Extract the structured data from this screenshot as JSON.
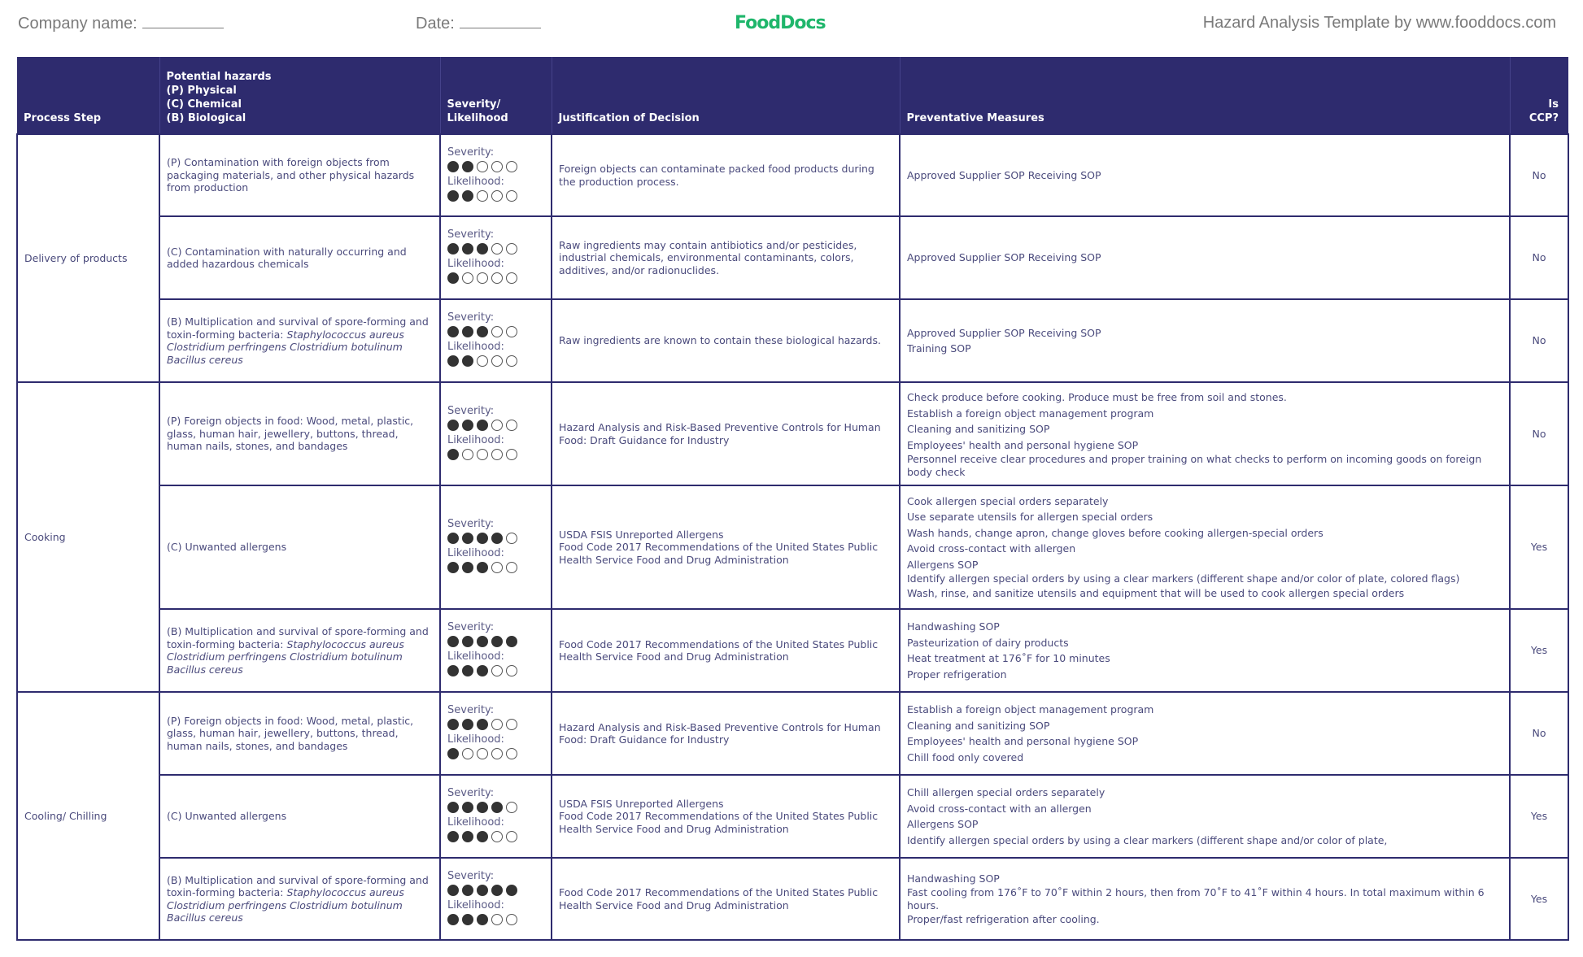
{
  "header": {
    "company_label": "Company name:",
    "date_label": "Date:",
    "logo_text": "FoodDocs",
    "credit": "Hazard Analysis Template by www.fooddocs.com"
  },
  "colors": {
    "header_bg": "#2e2b6e",
    "logo_green": "#1fb66b",
    "dot_filled": "#333333"
  },
  "columns": {
    "process_step": "Process Step",
    "hazards_title": "Potential hazards",
    "hazards_p": "(P) Physical",
    "hazards_c": "(C) Chemical",
    "hazards_b": "(B) Biological",
    "sev_line1": "Severity/",
    "sev_line2": "Likelihood",
    "justification": "Justification of Decision",
    "measures": "Preventative Measures",
    "ccp": "Is CCP?"
  },
  "labels": {
    "severity": "Severity:",
    "likelihood": "Likelihood:"
  },
  "steps": [
    {
      "name": "Delivery of products",
      "rows": [
        {
          "hazard": "(P) Contamination with foreign objects from packaging materials, and other physical hazards from production",
          "hazard_italic": "",
          "severity": 2,
          "likelihood": 2,
          "justification": [
            "Foreign objects can contaminate packed food products during the production process."
          ],
          "measures": [
            "Approved Supplier SOP Receiving SOP"
          ],
          "ccp": "No"
        },
        {
          "hazard": "(C) Contamination with naturally occurring and added hazardous chemicals",
          "hazard_italic": "",
          "severity": 3,
          "likelihood": 1,
          "justification": [
            "Raw ingredients may contain antibiotics and/or pesticides, industrial chemicals, environmental contaminants, colors, additives, and/or radionuclides."
          ],
          "measures": [
            "Approved Supplier SOP Receiving SOP"
          ],
          "ccp": "No"
        },
        {
          "hazard": "(B) Multiplication and survival of spore-forming and toxin-forming bacteria: ",
          "hazard_italic": "Staphylococcus aureus Clostridium perfringens Clostridium botulinum Bacillus cereus",
          "severity": 3,
          "likelihood": 2,
          "justification": [
            "Raw ingredients are known to contain these biological hazards."
          ],
          "measures": [
            "Approved Supplier SOP Receiving SOP",
            "Training SOP"
          ],
          "ccp": "No"
        }
      ]
    },
    {
      "name": "Cooking",
      "rows": [
        {
          "hazard": "(P) Foreign objects in food: Wood, metal, plastic, glass, human hair, jewellery, buttons, thread, human nails, stones, and bandages",
          "hazard_italic": "",
          "severity": 3,
          "likelihood": 1,
          "justification": [
            "Hazard Analysis and Risk-Based Preventive Controls for Human Food: Draft Guidance for Industry"
          ],
          "measures": [
            "Check produce before cooking. Produce must be free from soil and stones.",
            "Establish a foreign object management program",
            "Cleaning and sanitizing SOP",
            "Employees' health and personal hygiene SOP",
            "Personnel receive clear procedures and proper training on what checks to perform on incoming goods on foreign body check"
          ],
          "ccp": "No"
        },
        {
          "hazard": "(C) Unwanted allergens",
          "hazard_italic": "",
          "severity": 4,
          "likelihood": 3,
          "justification": [
            "USDA FSIS Unreported Allergens",
            "Food Code 2017 Recommendations of the United States Public Health Service Food and Drug Administration"
          ],
          "measures": [
            "Cook allergen special orders separately",
            "Use separate utensils for allergen special orders",
            "Wash hands, change apron, change gloves before cooking allergen-special orders",
            "Avoid cross-contact with allergen",
            "Allergens SOP",
            "Identify allergen special orders by using a clear markers (different shape and/or color of plate, colored flags)",
            "Wash, rinse, and sanitize utensils and equipment that will be used to cook allergen special orders"
          ],
          "ccp": "Yes"
        },
        {
          "hazard": "(B) Multiplication and survival of spore-forming and toxin-forming bacteria: ",
          "hazard_italic": "Staphylococcus aureus Clostridium perfringens Clostridium botulinum Bacillus cereus",
          "severity": 5,
          "likelihood": 3,
          "justification": [
            "Food Code 2017 Recommendations of the United States Public Health Service Food and Drug Administration"
          ],
          "measures": [
            "Handwashing SOP",
            "Pasteurization of dairy products",
            "Heat treatment at 176˚F for 10 minutes",
            "Proper refrigeration"
          ],
          "ccp": "Yes"
        }
      ]
    },
    {
      "name": "Cooling/ Chilling",
      "rows": [
        {
          "hazard": "(P) Foreign objects in food: Wood, metal, plastic, glass, human hair, jewellery, buttons, thread, human nails, stones, and bandages",
          "hazard_italic": "",
          "severity": 3,
          "likelihood": 1,
          "justification": [
            "Hazard Analysis and Risk-Based Preventive Controls for Human Food: Draft Guidance for Industry"
          ],
          "measures": [
            "Establish a foreign object management program",
            "Cleaning and sanitizing SOP",
            "Employees' health and personal hygiene SOP",
            "Chill food only covered"
          ],
          "ccp": "No"
        },
        {
          "hazard": "(C) Unwanted allergens",
          "hazard_italic": "",
          "severity": 4,
          "likelihood": 3,
          "justification": [
            "USDA FSIS Unreported Allergens",
            "Food Code 2017 Recommendations of the United States Public Health Service Food and Drug Administration"
          ],
          "measures": [
            "Chill allergen special orders separately",
            "Avoid cross-contact with an allergen",
            "Allergens SOP",
            "Identify allergen special orders by using a clear markers (different shape and/or color of plate,"
          ],
          "ccp": "Yes"
        },
        {
          "hazard": "(B) Multiplication and survival of spore-forming and toxin-forming bacteria: ",
          "hazard_italic": "Staphylococcus aureus Clostridium perfringens Clostridium botulinum Bacillus cereus",
          "severity": 5,
          "likelihood": 3,
          "justification": [
            "Food Code 2017 Recommendations of the United States Public Health Service Food and Drug Administration"
          ],
          "measures": [
            "Handwashing SOP",
            "Fast cooling from 176˚F to 70˚F within 2 hours, then from 70˚F to 41˚F within 4 hours. In total maximum within 6 hours.",
            "Proper/fast refrigeration after cooling."
          ],
          "ccp": "Yes"
        }
      ]
    }
  ]
}
